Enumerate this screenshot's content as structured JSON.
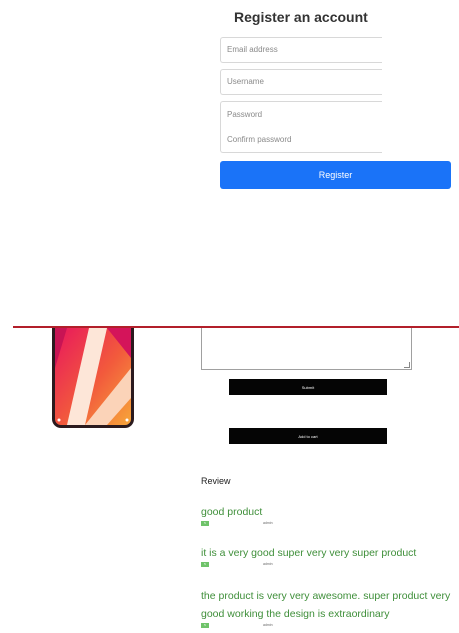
{
  "register": {
    "title": "Register an account",
    "email_placeholder": "Email address",
    "username_placeholder": "Username",
    "password_placeholder": "Password",
    "confirm_placeholder": "Confirm password",
    "button_label": "Register",
    "accent": "#1a73f8"
  },
  "product": {
    "submit_label": "Submit",
    "add_to_cart_label": "Add to cart"
  },
  "reviews": {
    "heading": "Review",
    "items": [
      {
        "text": "good product",
        "badge": "5",
        "author": "admin"
      },
      {
        "text": "it is a very good super very very super product",
        "badge": "5",
        "author": "admin"
      },
      {
        "text": "the product is very very awesome. super product very good working the design is extraordinary",
        "badge": "5",
        "author": "admin"
      }
    ]
  }
}
